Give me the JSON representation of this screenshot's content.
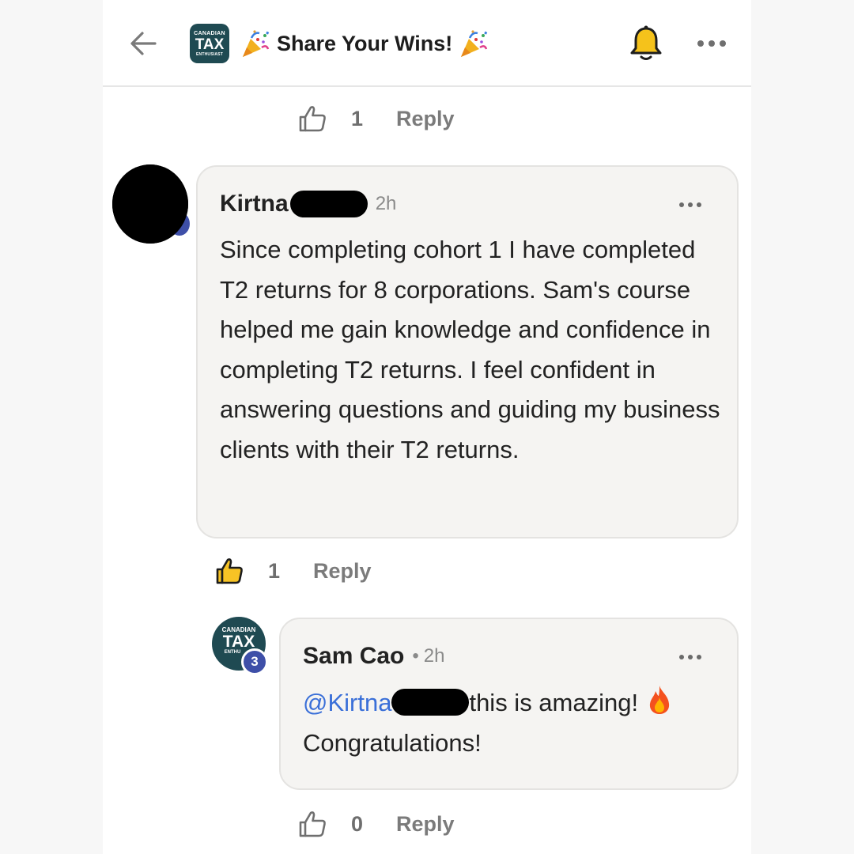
{
  "header": {
    "back_icon": "arrow-left-icon",
    "logo": {
      "line1": "CANADIAN",
      "line2": "TAX",
      "line3": "ENTHUSIAST"
    },
    "title": "Share Your Wins!",
    "title_icon": "party-popper-icon",
    "bell_icon": "bell-icon",
    "more_icon": "more-horizontal-icon"
  },
  "previous_comment_actions": {
    "like_count": "1",
    "reply_label": "Reply"
  },
  "comments": [
    {
      "author": "Kirtna",
      "time": "2h",
      "body": "Since completing cohort 1 I have completed T2 returns for 8 corporations. Sam's course helped me gain knowledge and confidence in completing T2 returns. I feel confident in answering questions and guiding my business clients with their T2 returns.",
      "like_count": "1",
      "liked": true,
      "reply_label": "Reply"
    },
    {
      "author": "Sam Cao",
      "separator": "•",
      "time": "2h",
      "avatar": {
        "line1": "CANADIAN",
        "line2": "TAX",
        "line3": "ENTHU"
      },
      "level_badge": "3",
      "mention": "@Kirtna",
      "body_line1": "this is amazing!",
      "body_line2": "Congratulations!",
      "emoji_icon": "fire-icon",
      "like_count": "0",
      "reply_label": "Reply"
    }
  ],
  "colors": {
    "brand_teal": "#1f4a52",
    "mention_blue": "#3a6fd8",
    "badge_blue": "#3e4fa8",
    "bell_yellow": "#f5c21b",
    "like_yellow": "#f7c325"
  }
}
